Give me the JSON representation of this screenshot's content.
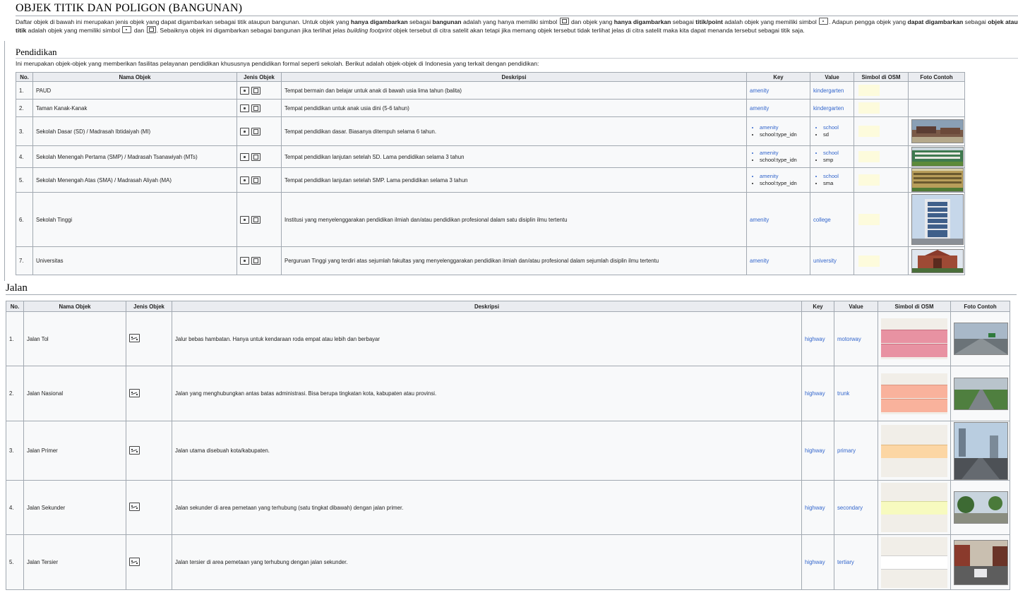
{
  "page": {
    "title": "OBJEK TITIK DAN POLIGON (BANGUNAN)",
    "intro": {
      "p1": "Daftar objek di bawah ini merupakan jenis objek yang dapat digambarkan sebagai titik ataupun bangunan. Untuk objek yang ",
      "b1": "hanya digambarkan",
      "p2": " sebagai ",
      "b2": "bangunan",
      "p3": " adalah yang hanya memiliki simbol ",
      "p4": " dan objek yang ",
      "b3": "hanya digambarkan",
      "p5": " sebagai ",
      "b4": "titik/point",
      "p6": " adalah objek yang memiliki simbol ",
      "p7": ". Adapun pengga objek yang ",
      "b5": "dapat digambarkan",
      "p8": " sebagai ",
      "b6": "objek atau titik",
      "p9": " adalah objek yang memiliki simbol ",
      "p10": " dan ",
      "p11": ". Sebaiknya objek ini digambarkan sebagai bangunan jika terlihat jelas ",
      "i1": "building footprint",
      "p12": " objek tersebut di citra satelit akan tetapi jika memang objek tersebut tidak terlihat jelas di citra satelit maka kita dapat menanda tersebut sebagai titik saja."
    }
  },
  "pendidikan": {
    "title": "Pendidikan",
    "intro": "Ini merupakan objek-objek yang memberikan fasilitas pelayanan pendidikan khususnya pendidikan formal seperti sekolah. Berikut adalah objek-objek di Indonesia yang terkait dengan pendidikan:",
    "headers": [
      "No.",
      "Nama Objek",
      "Jenis Objek",
      "Deskripsi",
      "Key",
      "Value",
      "Simbol di OSM",
      "Foto Contoh"
    ],
    "rows": [
      {
        "no": "1.",
        "name": "PAUD",
        "desc": "Tempat bermain dan belajar untuk anak di bawah usia lima tahun (balita)",
        "key": [
          "amenity"
        ],
        "value": [
          "kindergarten"
        ]
      },
      {
        "no": "2.",
        "name": "Taman Kanak-Kanak",
        "desc": "Tempat pendidikan untuk anak usia dini (5-6 tahun)",
        "key": [
          "amenity"
        ],
        "value": [
          "kindergarten"
        ]
      },
      {
        "no": "3.",
        "name": "Sekolah Dasar (SD) / Madrasah Ibtidaiyah (MI)",
        "desc": "Tempat pendidikan dasar. Biasanya ditempuh selama 6 tahun.",
        "key": [
          "amenity",
          "school:type_idn"
        ],
        "value": [
          "school",
          "sd"
        ]
      },
      {
        "no": "4.",
        "name": "Sekolah Menengah Pertama (SMP) / Madrasah Tsanawiyah (MTs)",
        "desc": "Tempat pendidikan lanjutan setelah SD. Lama pendidikan selama 3 tahun",
        "key": [
          "amenity",
          "school:type_idn"
        ],
        "value": [
          "school",
          "smp"
        ]
      },
      {
        "no": "5.",
        "name": "Sekolah Menengah Atas (SMA) / Madrasah Aliyah (MA)",
        "desc": "Tempat pendidikan lanjutan setelah SMP. Lama pendidikan selama 3 tahun",
        "key": [
          "amenity",
          "school:type_idn"
        ],
        "value": [
          "school",
          "sma"
        ]
      },
      {
        "no": "6.",
        "name": "Sekolah Tinggi",
        "desc": "Institusi yang menyelenggarakan pendidikan ilmiah dan/atau pendidikan profesional dalam satu disiplin ilmu tertentu",
        "key": [
          "amenity"
        ],
        "value": [
          "college"
        ]
      },
      {
        "no": "7.",
        "name": "Universitas",
        "desc": "Perguruan Tinggi yang terdiri atas sejumlah fakultas yang menyelenggarakan pendidikan ilmiah dan/atau profesional dalam sejumlah disiplin ilmu tertentu",
        "key": [
          "amenity"
        ],
        "value": [
          "university"
        ]
      }
    ]
  },
  "jalan": {
    "title": "Jalan",
    "headers": [
      "No.",
      "Nama Objek",
      "Jenis Objek",
      "Deskripsi",
      "Key",
      "Value",
      "Simbol di OSM",
      "Foto Contoh"
    ],
    "rows": [
      {
        "no": "1.",
        "name": "Jalan Tol",
        "desc": "Jalur bebas hambatan. Hanya untuk kendaraan roda empat atau lebih dan berbayar",
        "key": "highway",
        "value": "motorway",
        "color": "#e892a2"
      },
      {
        "no": "2.",
        "name": "Jalan Nasional",
        "desc": "Jalan yang menghubungkan antas batas administrasi. Bisa berupa tingkatan kota, kabupaten atau provinsi.",
        "key": "highway",
        "value": "trunk",
        "color": "#f9b29c"
      },
      {
        "no": "3.",
        "name": "Jalan Primer",
        "desc": "Jalan utama disebuah kota/kabupaten.",
        "key": "highway",
        "value": "primary",
        "color": "#fcd6a4"
      },
      {
        "no": "4.",
        "name": "Jalan Sekunder",
        "desc": "Jalan sekunder di area pemetaan yang terhubung (satu tingkat dibawah) dengan jalan primer.",
        "key": "highway",
        "value": "secondary",
        "color": "#f7fabf"
      },
      {
        "no": "5.",
        "name": "Jalan Tersier",
        "desc": "Jalan tersier di area pemetaan yang terhubung dengan jalan sekunder.",
        "key": "highway",
        "value": "tertiary",
        "color": "#ffffff"
      }
    ]
  },
  "colors": {
    "link": "#3366cc",
    "header_bg": "#eaecf0",
    "cell_bg": "#f8f9fa",
    "border": "#a2a9b1"
  }
}
